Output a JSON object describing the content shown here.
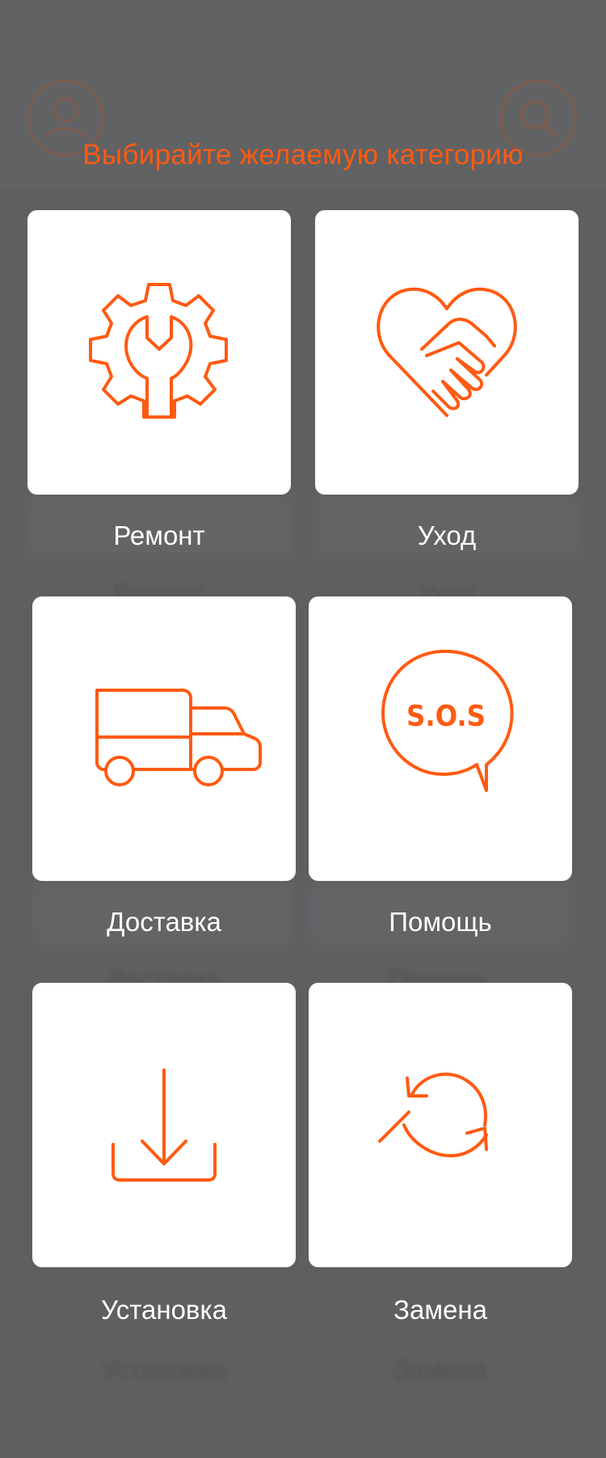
{
  "header": {
    "title": "Выбирайте желаемую категорию",
    "profile_icon": "user-icon",
    "search_icon": "search-icon"
  },
  "categories": [
    {
      "label": "Ремонт",
      "icon": "gear-wrench-icon"
    },
    {
      "label": "Уход",
      "icon": "heart-handshake-icon"
    },
    {
      "label": "Доставка",
      "icon": "truck-icon"
    },
    {
      "label": "Помощь",
      "icon": "sos-bubble-icon",
      "icon_text": "S.O.S"
    },
    {
      "label": "Установка",
      "icon": "download-tray-icon"
    },
    {
      "label": "Замена",
      "icon": "refresh-swap-icon"
    }
  ],
  "colors": {
    "accent": "#ff5a12",
    "overlay": "#5e5f61",
    "tile": "#ffffff",
    "label": "#ffffff"
  }
}
